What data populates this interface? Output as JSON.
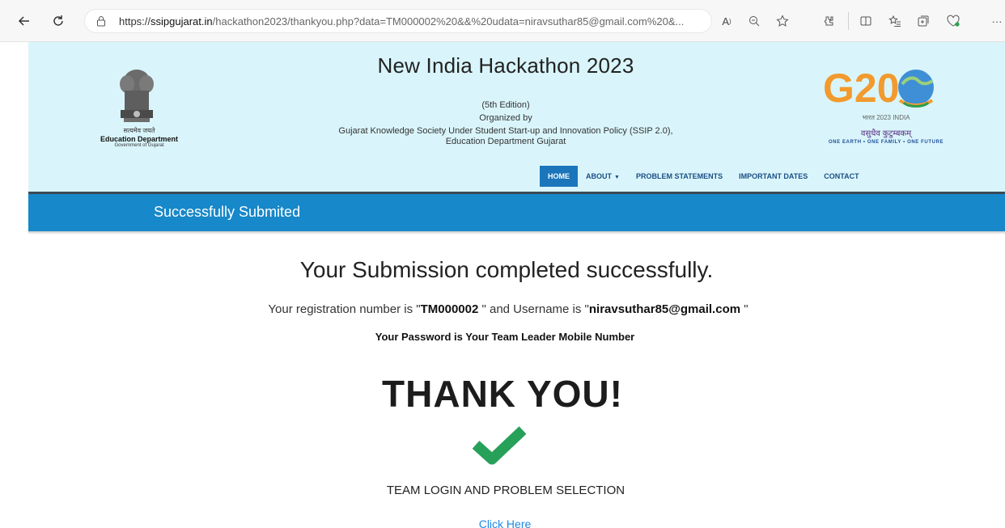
{
  "browser": {
    "url_prefix": "https://",
    "url_host": "ssipgujarat.in",
    "url_path": "/hackathon2023/thankyou.php?data=TM000002%20&&%20udata=niravsuthar85@gmail.com%20&..."
  },
  "header": {
    "title": "New India Hackathon 2023",
    "edition": "(5th Edition)",
    "organized_by": "Organized by",
    "org_line1": "Gujarat Knowledge Society Under Student Start-up and Innovation Policy (SSIP 2.0),",
    "org_line2": "Education Department Gujarat",
    "left_logo": {
      "hindi": "सत्यमेव जयते",
      "name": "Education Department",
      "sub": "Government of Gujarat"
    },
    "right_logo": {
      "mark": "G20",
      "bharat": "भारत 2023 INDIA",
      "hindi": "वसुधैव कुटुम्बकम्",
      "motto": "ONE EARTH • ONE FAMILY • ONE FUTURE"
    }
  },
  "nav": {
    "home": "HOME",
    "about": "ABOUT",
    "problems": "PROBLEM STATEMENTS",
    "dates": "IMPORTANT DATES",
    "contact": "CONTACT"
  },
  "banner": {
    "text": "Successfully Submited"
  },
  "content": {
    "headline": "Your Submission completed successfully.",
    "reg_prefix": "Your registration number is \"",
    "reg_number": "TM000002",
    "reg_middle": " \" and Username is \"",
    "username": "niravsuthar85@gmail.com",
    "reg_suffix": " \"",
    "password_note": "Your Password is Your Team Leader Mobile Number",
    "thank_you": "THANK YOU!",
    "team_login": "TEAM LOGIN AND PROBLEM SELECTION",
    "click_here": "Click Here"
  },
  "colors": {
    "header_bg": "#d9f5fb",
    "banner_bg": "#1788c9",
    "nav_active": "#1b75bb",
    "check_green": "#27a05a",
    "link": "#1e88e5"
  }
}
